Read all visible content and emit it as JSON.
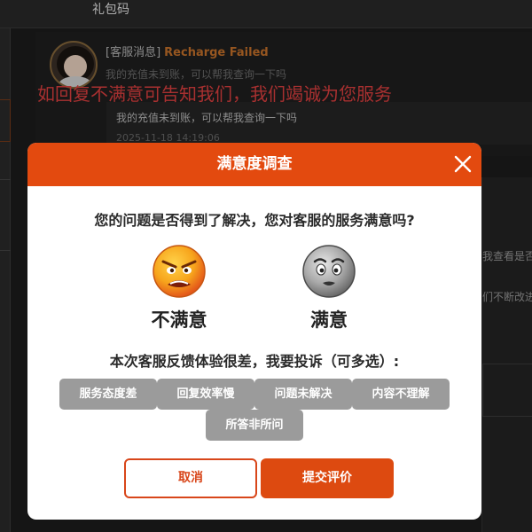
{
  "topbar": {
    "gift_code": "礼包码"
  },
  "message": {
    "tag": "[客服消息]",
    "title": "Recharge Failed",
    "preview": "我的充值未到账，可以帮我查询一下吗",
    "bubble_text": "我的充值未到账，可以帮我查询一下吗",
    "timestamp": "2025-11-18 14:19:06"
  },
  "banner": "如回复不满意可告知我们，我们竭诚为您服务",
  "right_panel": {
    "snippet1": "我查看是否",
    "snippet2": "们不断改进"
  },
  "modal": {
    "title": "满意度调查",
    "question": "您的问题是否得到了解决，您对客服的服务满意吗?",
    "unsatisfied_label": "不满意",
    "satisfied_label": "满意",
    "complaint_prompt": "本次客服反馈体验很差，我要投诉（可多选）:",
    "options": [
      "服务态度差",
      "回复效率慢",
      "问题未解决",
      "内容不理解",
      "所答非所问"
    ],
    "cancel_label": "取消",
    "submit_label": "提交评价"
  },
  "colors": {
    "accent": "#e34a0f",
    "chip_bg": "#9b9b9b",
    "banner_text": "#e04040",
    "title_orange": "#c9732b"
  },
  "icons": {
    "close": "close-icon",
    "unsatisfied": "angry-face-icon",
    "satisfied": "neutral-face-icon"
  }
}
